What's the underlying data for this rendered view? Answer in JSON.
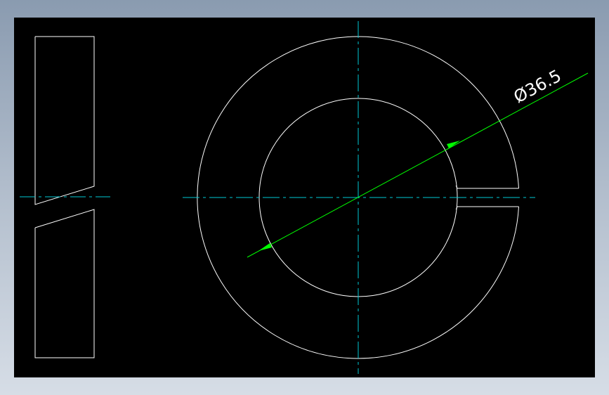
{
  "colors": {
    "background_frame": "#a9b6c6",
    "canvas": "#000000",
    "geometry": "#ffffff",
    "centerline": "#00c8d4",
    "dimension": "#00ff00"
  },
  "dimension": {
    "diameter_label": "Ø36.5"
  }
}
